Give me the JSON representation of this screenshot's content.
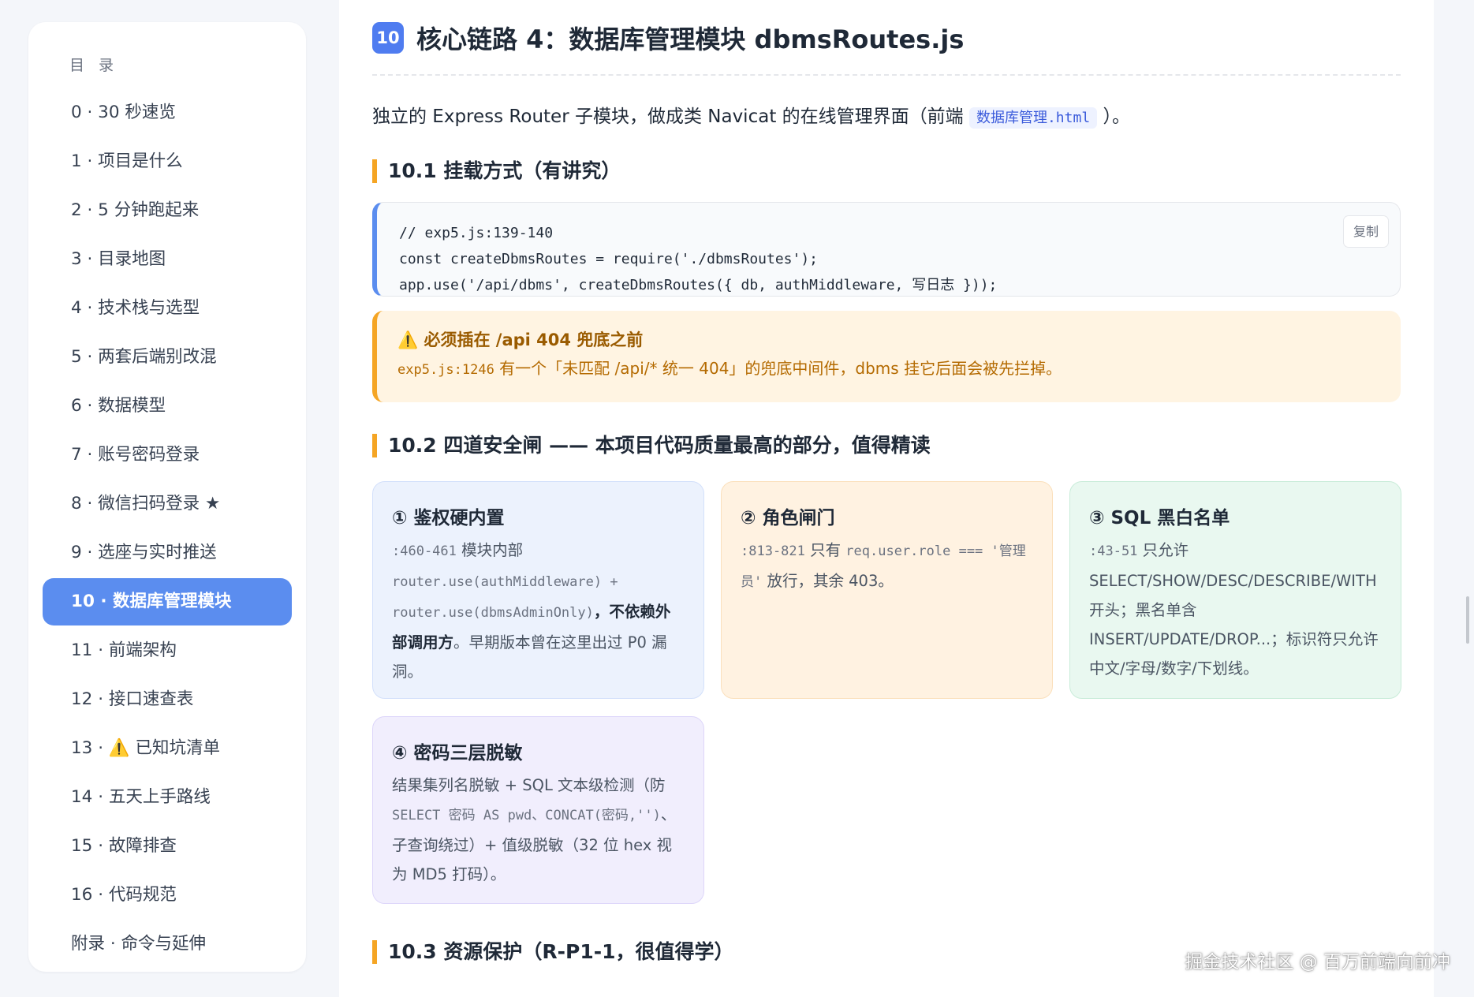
{
  "sidebar": {
    "title": "目 录",
    "items": [
      {
        "label": "0 · 30 秒速览"
      },
      {
        "label": "1 · 项目是什么"
      },
      {
        "label": "2 · 5 分钟跑起来"
      },
      {
        "label": "3 · 目录地图"
      },
      {
        "label": "4 · 技术栈与选型"
      },
      {
        "label": "5 · 两套后端别改混"
      },
      {
        "label": "6 · 数据模型"
      },
      {
        "label": "7 · 账号密码登录"
      },
      {
        "label": "8 · 微信扫码登录 ★"
      },
      {
        "label": "9 · 选座与实时推送"
      },
      {
        "label": "10 · 数据库管理模块",
        "active": true
      },
      {
        "label": "11 · 前端架构"
      },
      {
        "label": "12 · 接口速查表"
      },
      {
        "label": "13 · ⚠️ 已知坑清单"
      },
      {
        "label": "14 · 五天上手路线"
      },
      {
        "label": "15 · 故障排查"
      },
      {
        "label": "16 · 代码规范"
      },
      {
        "label": "附录 · 命令与延伸"
      }
    ]
  },
  "section": {
    "number": "10",
    "title": "核心链路 4：数据库管理模块 dbmsRoutes.js",
    "intro_prefix": "独立的 Express Router 子模块，做成类 Navicat 的在线管理界面（前端",
    "intro_code": "数据库管理.html",
    "intro_suffix": "）。"
  },
  "sub1": {
    "title": "10.1 挂载方式（有讲究）",
    "code_lines": [
      "// exp5.js:139-140",
      "const createDbmsRoutes = require('./dbmsRoutes');",
      "app.use('/api/dbms', createDbmsRoutes({ db, authMiddleware, 写日志 }));"
    ],
    "copy_label": "复制",
    "warn_icon": "⚠️",
    "warn_title": "必须插在 /api 404 兜底之前",
    "warn_code": "exp5.js:1246",
    "warn_text": " 有一个「未匹配 /api/* 统一 404」的兜底中间件，dbms 挂它后面会被先拦掉。"
  },
  "sub2": {
    "title": "10.2 四道安全闸 —— 本项目代码质量最高的部分，值得精读",
    "cards": [
      {
        "title": "① 鉴权硬内置",
        "code1": ":460-461",
        "text1": " 模块内部 ",
        "code2": "router.use(authMiddleware) + router.use(dbmsAdminOnly)",
        "bold": "，不依赖外部调用方",
        "text2": "。早期版本曾在这里出过 P0 漏洞。"
      },
      {
        "title": "② 角色闸门",
        "code1": ":813-821",
        "text1": " 只有 ",
        "code2": "req.user.role === '管理员'",
        "text2": " 放行，其余 403。"
      },
      {
        "title": "③ SQL 黑白名单",
        "code1": ":43-51",
        "text1": " 只允许 SELECT/SHOW/DESC/DESCRIBE/WITH 开头；黑名单含 INSERT/UPDATE/DROP...；标识符只允许中文/字母/数字/下划线。"
      },
      {
        "title": "④ 密码三层脱敏",
        "text1": "结果集列名脱敏 + SQL 文本级检测（防 ",
        "code1": "SELECT 密码 AS pwd、CONCAT(密码,'')",
        "text2": "、子查询绕过）+ 值级脱敏（32 位 hex 视为 MD5 打码）。"
      }
    ]
  },
  "sub3": {
    "title": "10.3 资源保护（R-P1-1，很值得学）"
  },
  "watermark": "掘金技术社区 @ 百万前端向前冲"
}
